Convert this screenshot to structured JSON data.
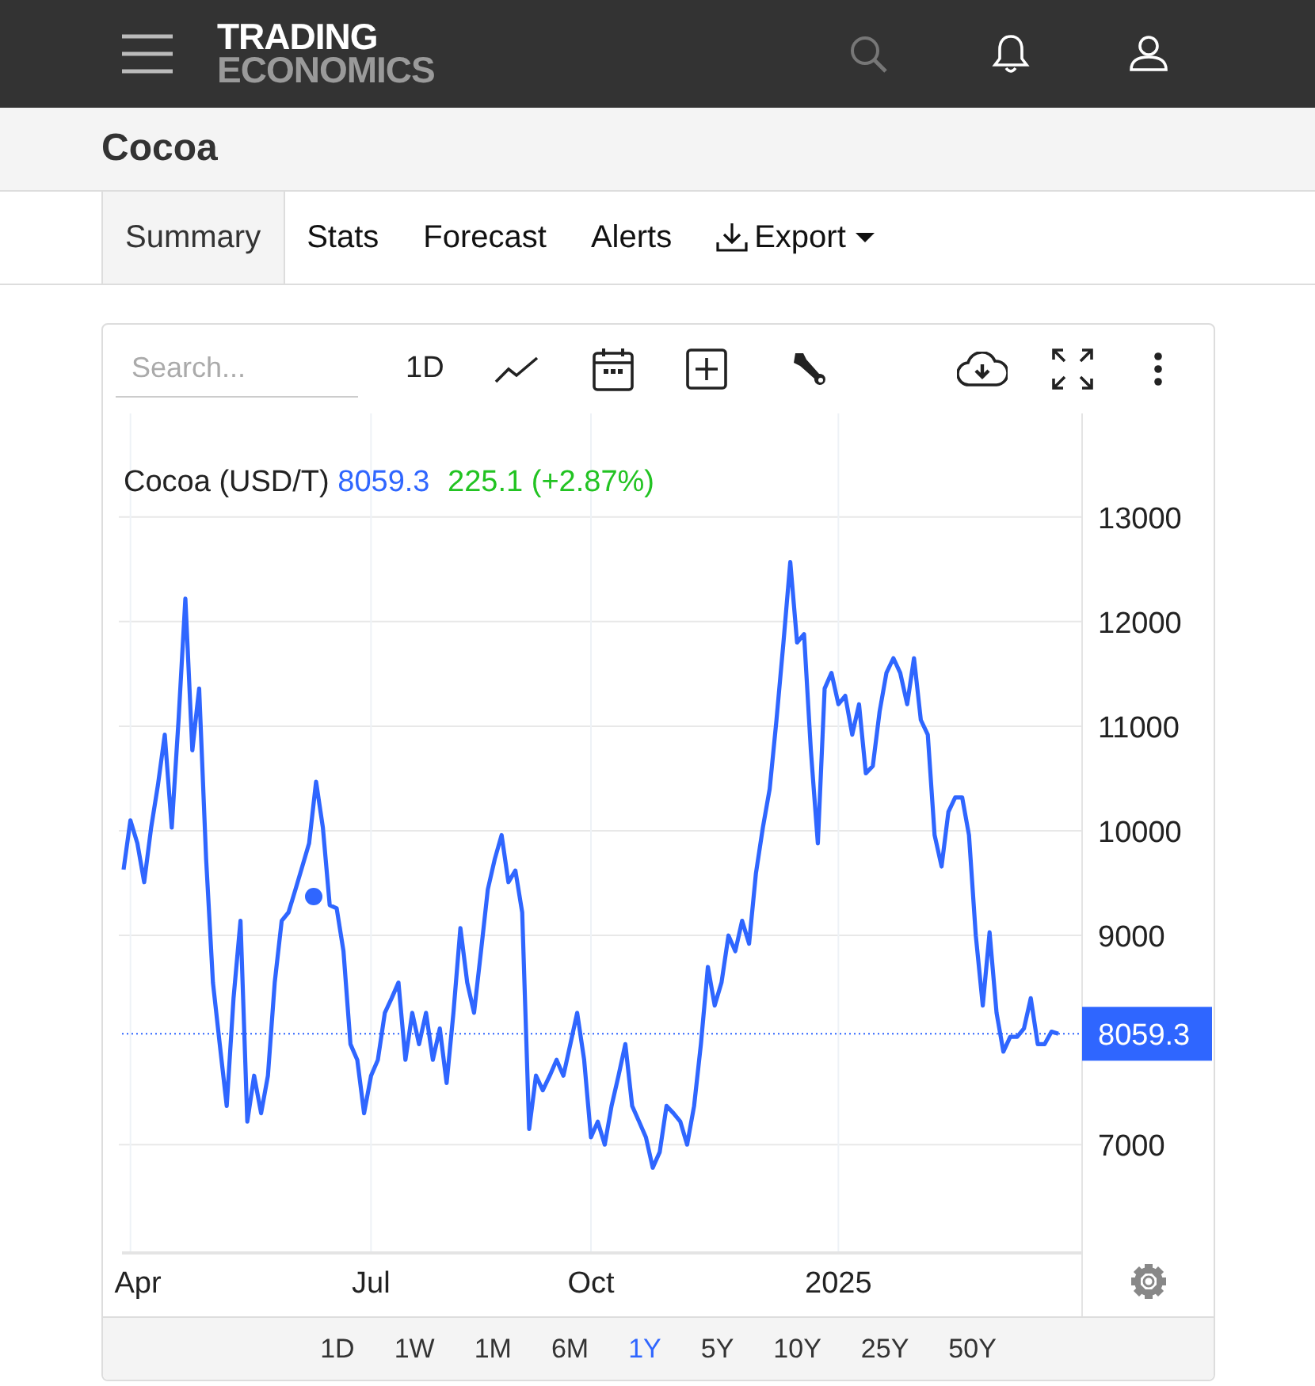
{
  "header": {
    "logo_line_1": "TRADING",
    "logo_line_2": "ECONOMICS"
  },
  "page_title": "Cocoa",
  "tabs": [
    {
      "label": "Summary",
      "selected": true,
      "kind": "link"
    },
    {
      "label": "Stats",
      "selected": false,
      "kind": "link"
    },
    {
      "label": "Forecast",
      "selected": false,
      "kind": "link"
    },
    {
      "label": "Alerts",
      "selected": false,
      "kind": "link"
    },
    {
      "label": "Export",
      "selected": false,
      "kind": "dropdown"
    }
  ],
  "toolbar": {
    "search": {
      "placeholder": "Search..."
    },
    "interval": "1D"
  },
  "chart": {
    "legend": {
      "price": "8059.3",
      "change": "225.1 (+2.87%)"
    },
    "last_value_label": "8059.3",
    "chart_data": {
      "type": "line",
      "categories": [
        null,
        "Apr",
        null,
        null,
        null,
        null,
        null,
        null,
        null,
        null,
        null,
        null,
        null,
        null,
        null,
        null,
        null,
        null,
        null,
        null,
        null,
        null,
        null,
        null,
        null,
        null,
        null,
        null,
        null,
        null,
        null,
        null,
        null,
        null,
        null,
        null,
        "Jul",
        null,
        null,
        null,
        null,
        null,
        null,
        null,
        null,
        null,
        null,
        null,
        null,
        null,
        null,
        null,
        null,
        null,
        null,
        null,
        null,
        null,
        null,
        null,
        null,
        null,
        null,
        null,
        null,
        null,
        null,
        null,
        "Oct",
        null,
        null,
        null,
        null,
        null,
        null,
        null,
        null,
        null,
        null,
        null,
        null,
        null,
        null,
        null,
        null,
        null,
        null,
        null,
        null,
        null,
        null,
        null,
        null,
        null,
        null,
        null,
        null,
        null,
        null,
        null,
        null,
        null,
        null,
        null,
        "2025",
        null,
        null,
        null,
        null,
        null,
        null,
        null,
        null,
        null,
        null,
        null,
        null,
        null,
        null,
        null,
        null,
        null,
        null,
        null,
        null,
        null,
        null,
        null,
        null,
        null,
        null,
        null,
        null,
        null,
        null,
        null,
        null
      ],
      "series": [
        {
          "name": "Cocoa (USD/T)",
          "color": "#2f66ff",
          "values": [
            9630,
            10100,
            9880,
            9510,
            10030,
            10440,
            10920,
            10030,
            11060,
            12220,
            10770,
            11360,
            9730,
            8550,
            7960,
            7370,
            8400,
            9140,
            7220,
            7660,
            7300,
            7660,
            8550,
            9140,
            9220,
            9440,
            9660,
            9880,
            10470,
            10030,
            9290,
            9260,
            8850,
            7960,
            7810,
            7300,
            7660,
            7810,
            8260,
            8400,
            8550,
            7810,
            8260,
            7960,
            8260,
            7810,
            8110,
            7590,
            8260,
            9070,
            8550,
            8260,
            8850,
            9440,
            9730,
            9960,
            9510,
            9620,
            9220,
            7150,
            7660,
            7520,
            7660,
            7810,
            7660,
            7960,
            8260,
            7810,
            7070,
            7220,
            7000,
            7370,
            7660,
            7960,
            7370,
            7220,
            7070,
            6780,
            6930,
            7370,
            7300,
            7220,
            7000,
            7370,
            7960,
            8700,
            8330,
            8550,
            9000,
            8850,
            9140,
            8920,
            9590,
            10030,
            10400,
            11060,
            11800,
            12570,
            11800,
            11880,
            10770,
            9880,
            11360,
            11510,
            11210,
            11290,
            10920,
            11210,
            10550,
            10620,
            11140,
            11510,
            11650,
            11510,
            11210,
            11650,
            11060,
            10920,
            9960,
            9660,
            10180,
            10320,
            10320,
            9960,
            9000,
            8330,
            9030,
            8260,
            7890,
            8030,
            8030,
            8110,
            8400,
            7960,
            7960,
            8080,
            8060
          ]
        }
      ],
      "ylim": [
        5965,
        13990
      ],
      "yticks": [
        7000,
        9000,
        10000,
        11000,
        12000,
        13000
      ],
      "grid": true,
      "ref_lines": [
        {
          "axis": "y",
          "value": 8060,
          "color": "#2f66ff"
        }
      ]
    }
  },
  "ranges": [
    {
      "label": "1D",
      "selected": false
    },
    {
      "label": "1W",
      "selected": false
    },
    {
      "label": "1M",
      "selected": false
    },
    {
      "label": "6M",
      "selected": false
    },
    {
      "label": "1Y",
      "selected": true
    },
    {
      "label": "5Y",
      "selected": false
    },
    {
      "label": "10Y",
      "selected": false
    },
    {
      "label": "25Y",
      "selected": false
    },
    {
      "label": "50Y",
      "selected": false
    }
  ]
}
